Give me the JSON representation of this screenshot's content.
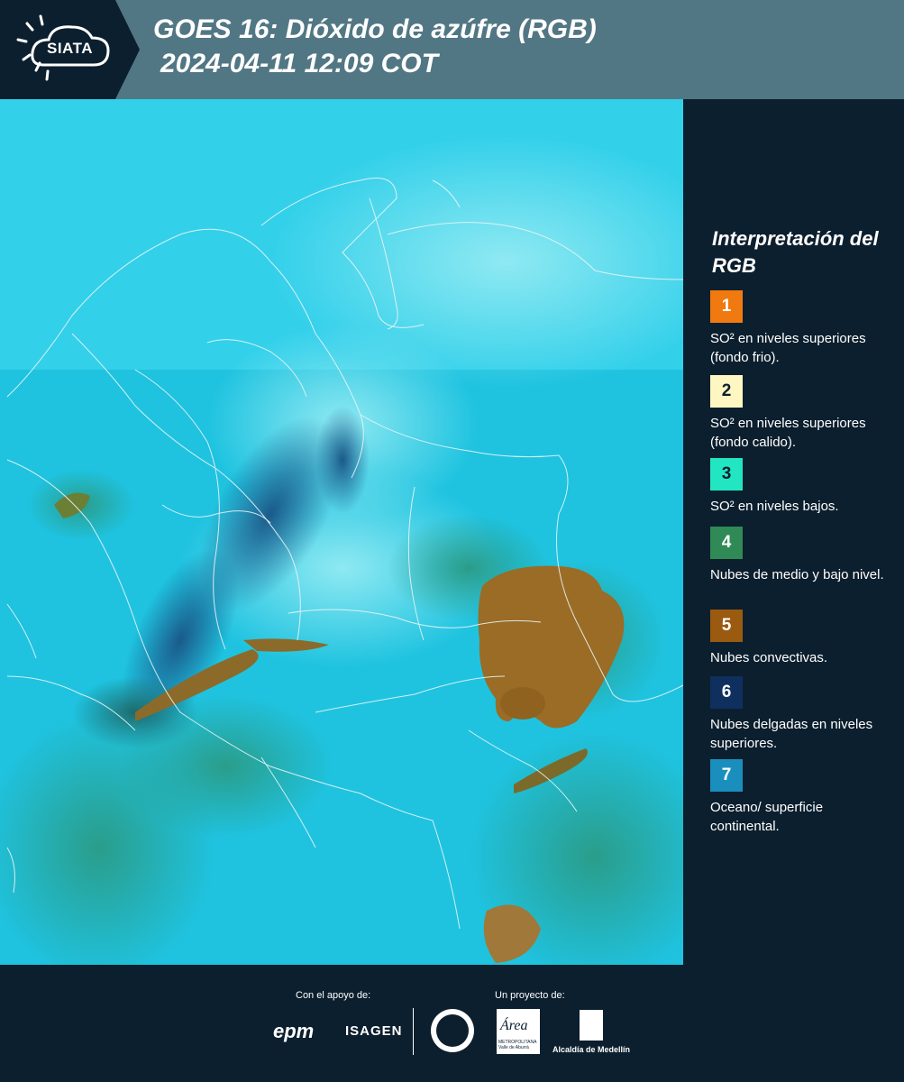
{
  "header": {
    "logo": "SIATA",
    "title": "GOES 16: Dióxido de azúfre (RGB)",
    "subtitle": "2024-04-11 12:09 COT"
  },
  "legend": {
    "title": "Interpretación del RGB",
    "items": [
      {
        "number": "1",
        "color": "#f07a10",
        "label": "SO² en niveles superiores (fondo frio)."
      },
      {
        "number": "2",
        "color": "#fff7c2",
        "label": "SO² en niveles superiores (fondo calido)."
      },
      {
        "number": "3",
        "color": "#22e6c2",
        "label": "SO² en niveles bajos."
      },
      {
        "number": "4",
        "color": "#2f8a55",
        "label": "Nubes de medio y bajo nivel."
      },
      {
        "number": "5",
        "color": "#9a5a10",
        "label": "Nubes convectivas."
      },
      {
        "number": "6",
        "color": "#0f2f5e",
        "label": "Nubes delgadas en niveles superiores."
      },
      {
        "number": "7",
        "color": "#1a8fbe",
        "label": "Oceano/ superficie continental."
      }
    ]
  },
  "footer": {
    "support_label": "Con el apoyo de:",
    "project_label": "Un proyecto de:",
    "epm": "epm",
    "isagen": "ISAGEN",
    "area": "Área",
    "area_sub": "METROPOLITANA Valle de Aburrá",
    "alcaldia": "Alcaldía de Medellín"
  }
}
